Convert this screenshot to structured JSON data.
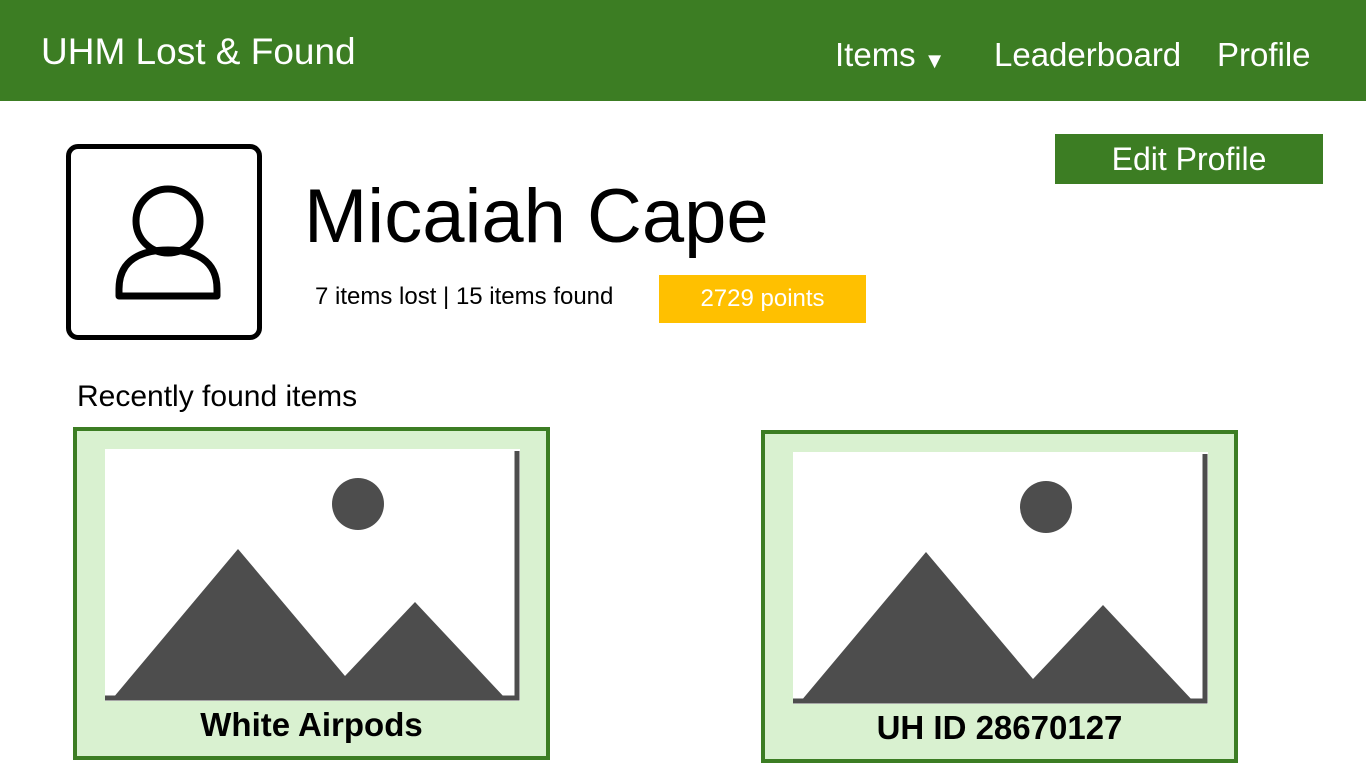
{
  "header": {
    "brand": "UHM Lost & Found",
    "nav": {
      "items_label": "Items",
      "items_caret": "▼",
      "leaderboard_label": "Leaderboard",
      "profile_label": "Profile"
    },
    "color": "#3c7d23"
  },
  "profile": {
    "name": "Micaiah Cape",
    "stats": "7 items lost | 15 items found",
    "points": "2729 points",
    "points_color": "#ffc000",
    "avatar_icon": "user-icon",
    "edit_label": "Edit Profile"
  },
  "recent": {
    "title": "Recently found items",
    "items": [
      {
        "label": "White Airpods",
        "icon": "image-placeholder-icon"
      },
      {
        "label": "UH ID 28670127",
        "icon": "image-placeholder-icon"
      }
    ],
    "card_background": "#d9f1d0"
  }
}
